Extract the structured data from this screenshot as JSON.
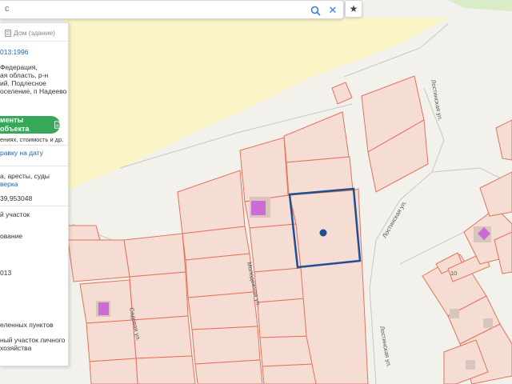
{
  "search": {
    "query": "с",
    "clear_symbol": "✕",
    "star_symbol": "★"
  },
  "panel": {
    "tab_label": "Дом (здание)",
    "cad_number": "013:1996",
    "addr_line1": "Федерация,",
    "addr_line2": "ая область, р-н",
    "addr_line3": "ий, Подлесное",
    "addr_line4": "оселение, п Надеево",
    "docs_button": "менты объекта",
    "docs_subtitle": "ениях, стоимость и др.",
    "statement_link": "равку на дату",
    "checks_line": "а, аресты, суды",
    "check_link": "верка",
    "cost": "39,953048",
    "type": "й участок",
    "use_label": "ование",
    "date": "013",
    "category": "еленных пунктов",
    "purpose_line1": "ный участок личного",
    "purpose_line2": "хозяйства"
  },
  "map": {
    "streets": {
      "molodezhnaya": "Молодежная ул.",
      "lostinskaya_top": "Лостинская ул.",
      "lostinskaya_mid": "Лостинская ул.",
      "lostinskaya_bottom": "Лостинская ул.",
      "sadovaya": "Садовая ул."
    },
    "parcel_number": "10",
    "colors": {
      "background": "#f3f1ec",
      "forest": "#fbf4c6",
      "green": "#d9ecc8",
      "parcel_fill": "#f6ddd3",
      "parcel_stroke": "#e2735a",
      "selection": "#1f4f93",
      "building": "#cc6ad6",
      "accent_green": "#35a85a",
      "link_blue": "#1b66b3"
    }
  }
}
